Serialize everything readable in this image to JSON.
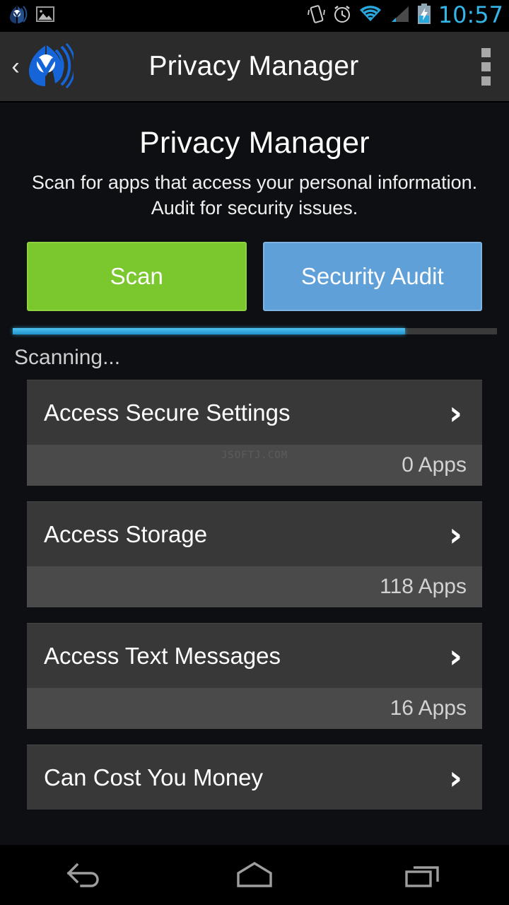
{
  "status_bar": {
    "time": "10:57",
    "left_icons": [
      {
        "name": "malwarebytes-notification-icon",
        "color": "#1b3a6b"
      },
      {
        "name": "photo-icon",
        "color": "#b0b0b0"
      }
    ],
    "right_icons": [
      {
        "name": "vibrate-icon",
        "color": "#cfcfcf"
      },
      {
        "name": "alarm-clock-icon",
        "color": "#cfcfcf"
      },
      {
        "name": "wifi-icon",
        "color": "#29a8dd"
      },
      {
        "name": "cellular-signal-icon",
        "color": "#4a4a4a"
      },
      {
        "name": "battery-charging-icon",
        "color": "#29a8dd"
      }
    ],
    "clock_color": "#34b6e8"
  },
  "action_bar": {
    "back_glyph": "‹",
    "title": "Privacy Manager",
    "overflow_label": "More options",
    "background": "#2b2b2b",
    "logo_color": "#1565d8"
  },
  "header": {
    "title": "Privacy Manager",
    "description": "Scan for apps that access your personal information. Audit for security issues."
  },
  "actions": {
    "scan_label": "Scan",
    "scan_color": "#7ac72e",
    "audit_label": "Security Audit",
    "audit_color": "#5fa0d8"
  },
  "progress": {
    "percent": 81,
    "status_text": "Scanning...",
    "fill_color": "#33b2e5",
    "track_color": "#3a3a3a"
  },
  "permission_list": [
    {
      "label": "Access Secure Settings",
      "count": "0 Apps",
      "chevron": "›"
    },
    {
      "label": "Access Storage",
      "count": "118 Apps",
      "chevron": "›"
    },
    {
      "label": "Access Text Messages",
      "count": "16 Apps",
      "chevron": "›"
    },
    {
      "label": "Can Cost You Money",
      "count": "",
      "chevron": "›"
    }
  ],
  "watermark": "JSOFTJ.COM",
  "nav_bar": {
    "back_label": "Back",
    "home_label": "Home",
    "recents_label": "Recent apps",
    "icon_color": "#9e9e9e"
  }
}
